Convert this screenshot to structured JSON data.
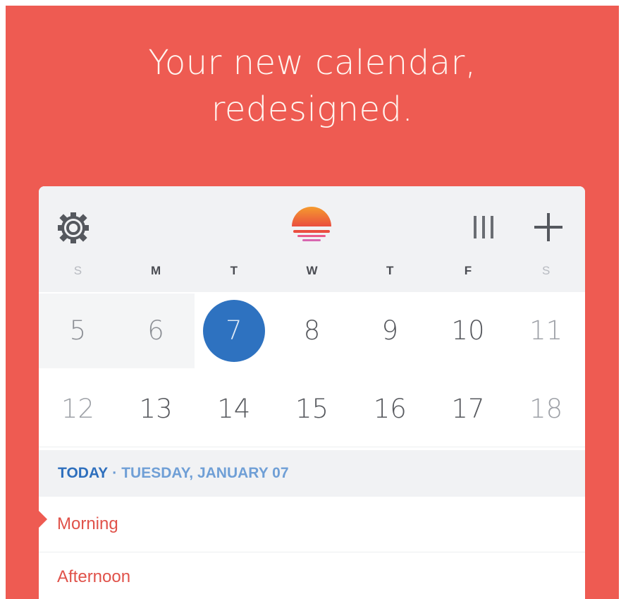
{
  "hero": {
    "line1": "Your new calendar,",
    "line2": "redesigned."
  },
  "toolbar": {
    "icons": [
      "gear-icon",
      "sun-logo-icon",
      "view-toggle-icon",
      "plus-icon"
    ]
  },
  "weekdays": [
    "S",
    "M",
    "T",
    "W",
    "T",
    "F",
    "S"
  ],
  "weeks": [
    [
      "5",
      "6",
      "7",
      "8",
      "9",
      "10",
      "11"
    ],
    [
      "12",
      "13",
      "14",
      "15",
      "16",
      "17",
      "18"
    ]
  ],
  "selected_day": "7",
  "agenda": {
    "today_label": "TODAY",
    "separator": "·",
    "date_label": "TUESDAY, JANUARY 07",
    "sections": [
      "Morning",
      "Afternoon"
    ]
  },
  "colors": {
    "brand": "#ee5b52",
    "selected": "#2e72c0",
    "section_text": "#e0524a"
  }
}
